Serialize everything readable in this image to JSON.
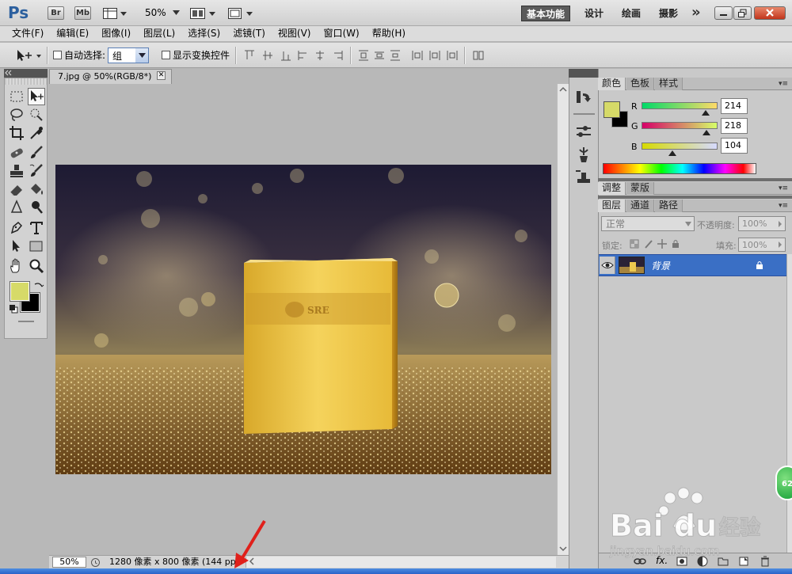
{
  "app": {
    "logo": "Ps",
    "bridge_label": "Br",
    "minibridge_label": "Mb",
    "zoom_dropdown": "50%",
    "workspaces": [
      {
        "label": "基本功能",
        "active": true
      },
      {
        "label": "设计",
        "active": false
      },
      {
        "label": "绘画",
        "active": false
      },
      {
        "label": "摄影",
        "active": false
      }
    ],
    "more_workspaces": "»"
  },
  "menu": [
    "文件(F)",
    "编辑(E)",
    "图像(I)",
    "图层(L)",
    "选择(S)",
    "滤镜(T)",
    "视图(V)",
    "窗口(W)",
    "帮助(H)"
  ],
  "options": {
    "auto_select_label": "自动选择:",
    "auto_select_value": "组",
    "show_transform_label": "显示变换控件"
  },
  "document": {
    "tab_title": "7.jpg @ 50%(RGB/8*)",
    "close_glyph": "✕",
    "zoom": "50%",
    "info": "1280 像素 x 800 像素 (144 ppi)"
  },
  "color_panel": {
    "tabs": [
      "颜色",
      "色板",
      "样式"
    ],
    "foreground": "#d6da68",
    "background": "#000000",
    "channels": [
      {
        "label": "R",
        "value": "214",
        "fraction": 0.839
      },
      {
        "label": "G",
        "value": "218",
        "fraction": 0.855
      },
      {
        "label": "B",
        "value": "104",
        "fraction": 0.408
      }
    ]
  },
  "adjust_panel": {
    "tabs": [
      "调整",
      "蒙版"
    ]
  },
  "layers_panel": {
    "tabs": [
      "图层",
      "通道",
      "路径"
    ],
    "blend_mode": "正常",
    "opacity_label": "不透明度:",
    "opacity_value": "100%",
    "lock_label": "锁定:",
    "fill_label": "填充:",
    "fill_value": "100%",
    "layers": [
      {
        "name": "背景",
        "selected": true
      }
    ],
    "footer_fx": "fx."
  },
  "badge": {
    "text": "62"
  },
  "colors": {
    "accent": "#3a6fc5",
    "foreground_swatch": "#d6da68"
  }
}
